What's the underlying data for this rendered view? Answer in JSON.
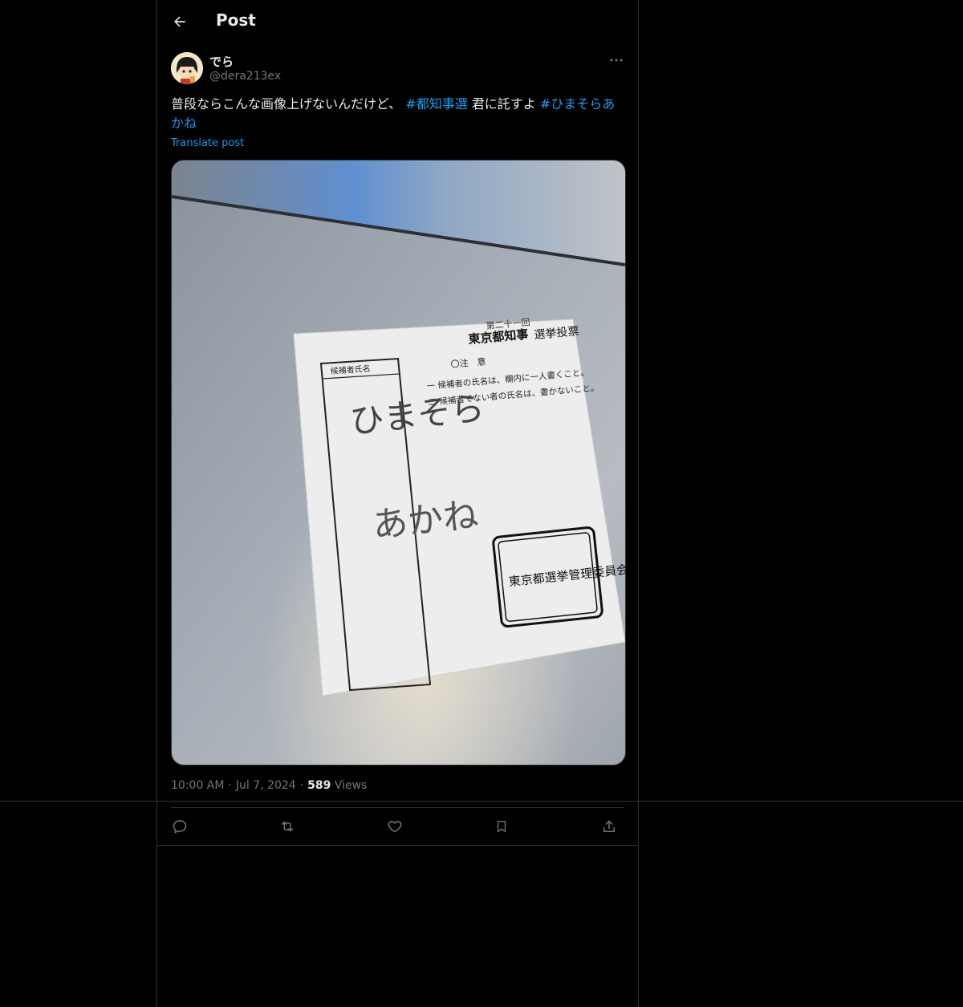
{
  "header": {
    "title": "Post",
    "back_icon": "arrow-left-icon"
  },
  "author": {
    "display_name": "でら",
    "handle": "@dera213ex",
    "avatar": "avatar-image"
  },
  "tweet": {
    "text_segments": [
      {
        "text": "普段ならこんな画像上げないんだけど、 ",
        "hashtag": false
      },
      {
        "text": "#都知事選",
        "hashtag": true
      },
      {
        "text": " 君に託すよ ",
        "hashtag": false
      },
      {
        "text": "#ひまそらあかね",
        "hashtag": true
      }
    ],
    "translate_label": "Translate post"
  },
  "ballot": {
    "header_small": "第二十一回",
    "title_bold": "東京都知事",
    "title_rest": "選挙投票",
    "notice_label": "〇注　意",
    "rule_1": "一 候補者の氏名は、欄内に一人書くこと。",
    "rule_2": "二 候補者でない者の氏名は、書かないこと。",
    "box_label": "候補者氏名",
    "handwritten_line_1": "ひまそら",
    "handwritten_line_2": "あかね",
    "seal_text": "東京都選挙管理委員会"
  },
  "meta": {
    "time": "10:00 AM",
    "separator": "·",
    "date": "Jul 7, 2024",
    "views_count": "589",
    "views_label": "Views"
  },
  "actions": {
    "reply": "reply-icon",
    "repost": "repost-icon",
    "like": "like-icon",
    "bookmark": "bookmark-icon",
    "share": "share-icon"
  },
  "colors": {
    "background": "#000000",
    "text": "#e7e9ea",
    "secondary": "#71767b",
    "accent": "#1d9bf0",
    "border": "#2f3336"
  }
}
